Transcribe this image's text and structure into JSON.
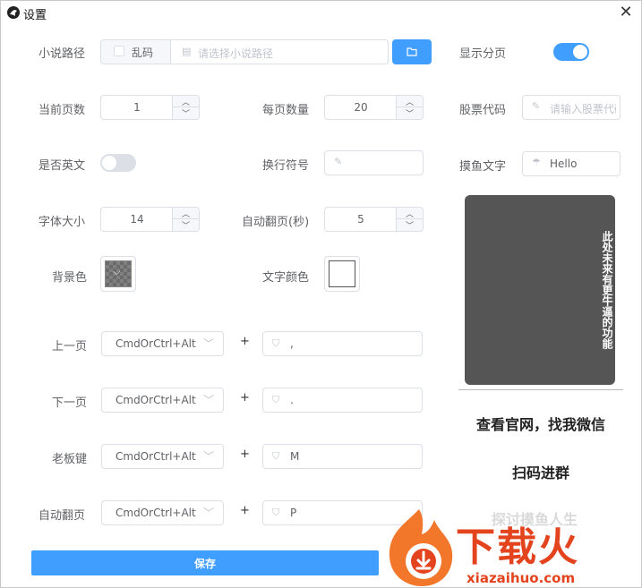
{
  "window": {
    "title": "设置"
  },
  "novel_path": {
    "label": "小说路径",
    "garble_label": "乱码",
    "placeholder": "请选择小说路径"
  },
  "show_paging": {
    "label": "显示分页",
    "on": true
  },
  "current_page": {
    "label": "当前页数",
    "value": "1"
  },
  "per_page": {
    "label": "每页数量",
    "value": "20"
  },
  "stock_code": {
    "label": "股票代码",
    "placeholder": "请输入股票代码"
  },
  "is_english": {
    "label": "是否英文",
    "on": false
  },
  "line_break": {
    "label": "换行符号",
    "value": ""
  },
  "fish_text": {
    "label": "摸鱼文字",
    "value": "Hello"
  },
  "font_size": {
    "label": "字体大小",
    "value": "14"
  },
  "auto_page_seconds": {
    "label": "自动翻页(秒)",
    "value": "5"
  },
  "bg_color": {
    "label": "背景色"
  },
  "text_color": {
    "label": "文字颜色"
  },
  "shortcuts": [
    {
      "label": "上一页",
      "modifier": "CmdOrCtrl+Alt",
      "key": ","
    },
    {
      "label": "下一页",
      "modifier": "CmdOrCtrl+Alt",
      "key": "."
    },
    {
      "label": "老板键",
      "modifier": "CmdOrCtrl+Alt",
      "key": "M"
    },
    {
      "label": "自动翻页",
      "modifier": "CmdOrCtrl+Alt",
      "key": "P"
    }
  ],
  "plus_sign": "+",
  "save_label": "保存",
  "side": {
    "banner_text": "此处未来有更牛逼的功能",
    "wechat": "查看官网，找我微信",
    "scan": "扫码进群",
    "faded": "探讨摸鱼人生"
  },
  "watermark": {
    "word": "下载火",
    "url": "xiazaihuo.com"
  },
  "colors": {
    "accent": "#409eff",
    "switch_off": "#dcdfe6",
    "banner_bg": "#555555",
    "watermark": "#e3431d"
  }
}
